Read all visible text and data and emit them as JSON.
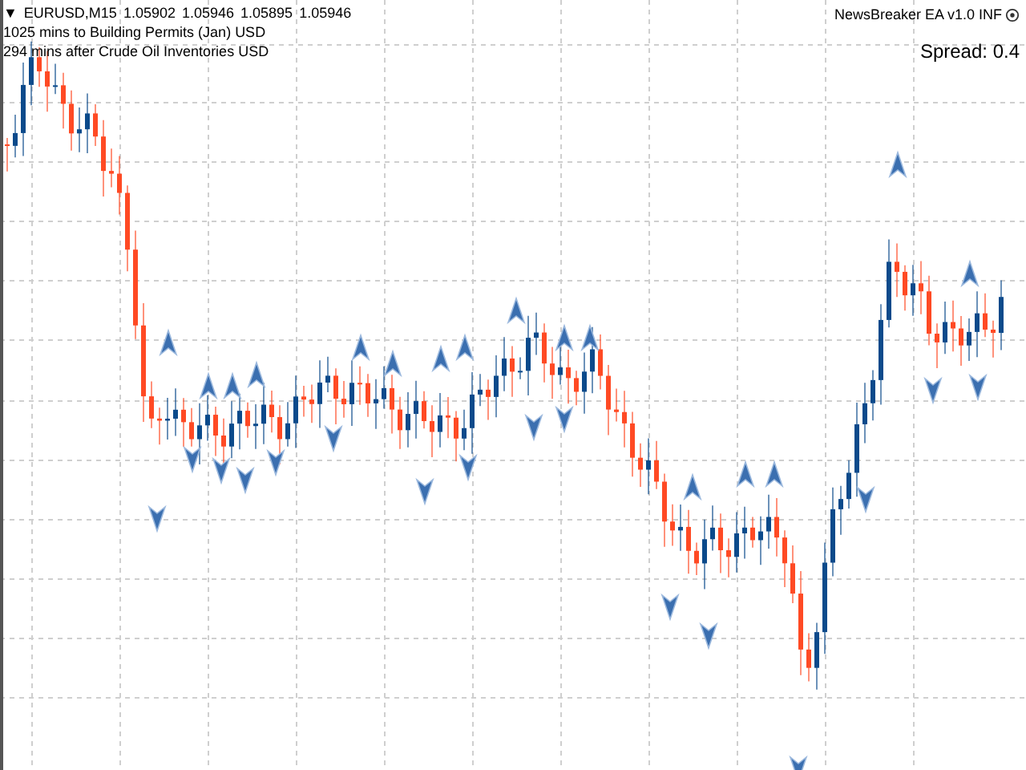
{
  "chart_header": {
    "toggle": "▼",
    "symbol": "EURUSD,M15",
    "quotes": [
      "1.05902",
      "1.05946",
      "1.05895",
      "1.05946"
    ]
  },
  "news": [
    "1025 mins to Building Permits (Jan) USD",
    "294 mins after Crude Oil Inventories USD"
  ],
  "ea_label": "NewsBreaker EA v1.0 INF",
  "spread": "Spread: 0.4"
}
